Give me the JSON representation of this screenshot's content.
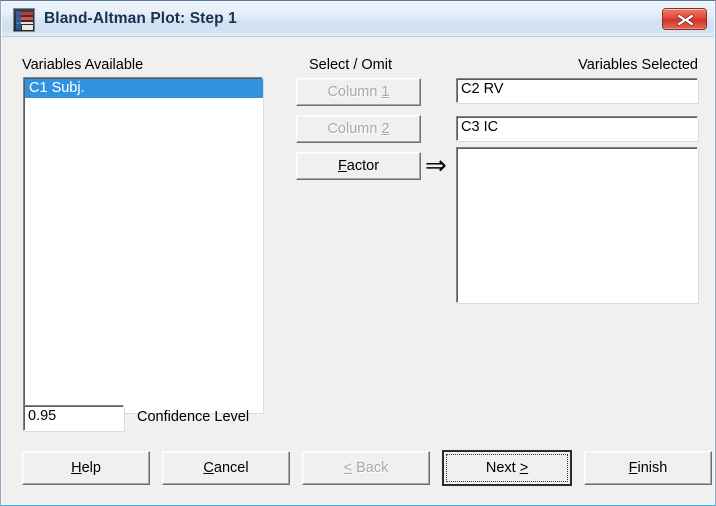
{
  "window": {
    "title": "Bland-Altman Plot: Step 1",
    "icon": "plot-icon",
    "close_label": "x",
    "accent_titlebar": "#d4e4f3",
    "accent_close": "#cf3325",
    "body_bg": "#f0f0f0",
    "selection_color": "#2f93e0"
  },
  "left_panel": {
    "label": "Variables Available",
    "items": [
      {
        "text": "C1 Subj.",
        "selected": true
      }
    ]
  },
  "center_panel": {
    "label": "Select / Omit",
    "buttons": [
      {
        "name": "column-1-button",
        "label": "Column 1",
        "accel": "1",
        "disabled": true
      },
      {
        "name": "column-2-button",
        "label": "Column 2",
        "accel": "2",
        "disabled": true
      },
      {
        "name": "factor-button",
        "label": "Factor",
        "accel": "F",
        "disabled": false
      }
    ],
    "arrow_glyph": "⇒"
  },
  "right_panel": {
    "label": "Variables Selected",
    "fields": [
      {
        "name": "selected-variable-1",
        "value": "C2 RV"
      },
      {
        "name": "selected-variable-2",
        "value": "C3 IC"
      }
    ],
    "list_items": []
  },
  "confidence": {
    "value": "0.95",
    "label": "Confidence Level"
  },
  "footer": {
    "buttons": [
      {
        "name": "help-button",
        "label": "Help",
        "accel": "H",
        "disabled": false,
        "default": false
      },
      {
        "name": "cancel-button",
        "label": "Cancel",
        "accel": "C",
        "disabled": false,
        "default": false
      },
      {
        "name": "back-button",
        "label": "< Back",
        "accel": "<",
        "disabled": true,
        "default": false
      },
      {
        "name": "next-button",
        "label": "Next >",
        "accel": ">",
        "disabled": false,
        "default": true
      },
      {
        "name": "finish-button",
        "label": "Finish",
        "accel": "F",
        "disabled": false,
        "default": false
      }
    ]
  }
}
